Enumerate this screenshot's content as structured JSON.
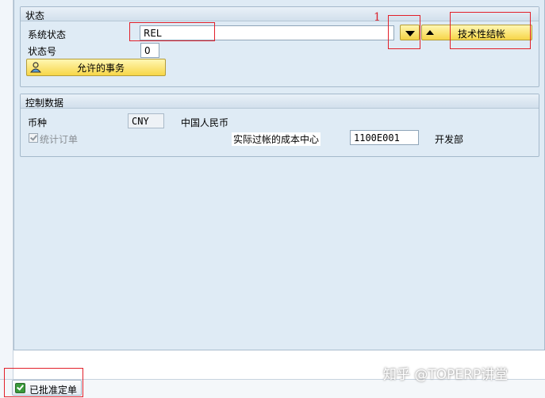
{
  "status_group": {
    "title": "状态",
    "system_status_label": "系统状态",
    "system_status_value": "REL",
    "status_no_label": "状态号",
    "status_no_value": "0",
    "allowed_trans_button": "允许的事务",
    "tech_close_button": "技术性结帐",
    "annotation_number": "1"
  },
  "control_group": {
    "title": "控制数据",
    "currency_label": "币种",
    "currency_value": "CNY",
    "currency_desc": "中国人民币",
    "stat_order_label": "统计订单",
    "actual_cost_center_label": "实际过帐的成本中心",
    "actual_cost_center_value": "1100E001",
    "cost_center_desc": "开发部"
  },
  "footer": {
    "approved_label": "已批准定单"
  },
  "watermark": {
    "text": "知乎 @TOPERP讲堂"
  },
  "colors": {
    "panel_bg": "#dfebf5",
    "button_yellow": "#f7d648",
    "annotation_red": "#e2202a"
  }
}
